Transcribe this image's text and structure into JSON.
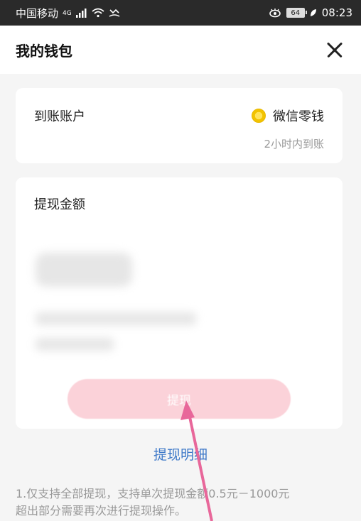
{
  "status_bar": {
    "carrier": "中国移动",
    "network": "4G",
    "battery": "64",
    "time": "08:23"
  },
  "header": {
    "title": "我的钱包"
  },
  "account_card": {
    "label": "到账账户",
    "wallet_name": "微信零钱",
    "arrival_time": "2小时内到账"
  },
  "amount_card": {
    "label": "提现金额",
    "withdraw_button_label": "提现"
  },
  "detail_link": "提现明细",
  "notice": {
    "line1": "1.仅支持全部提现，支持单次提现金额0.5元－1000元",
    "line2": "超出部分需要再次进行提现操作。"
  },
  "colors": {
    "accent_pink": "#fbd2d9",
    "link_blue": "#3d78c8",
    "annotation_arrow": "#e8679a"
  }
}
